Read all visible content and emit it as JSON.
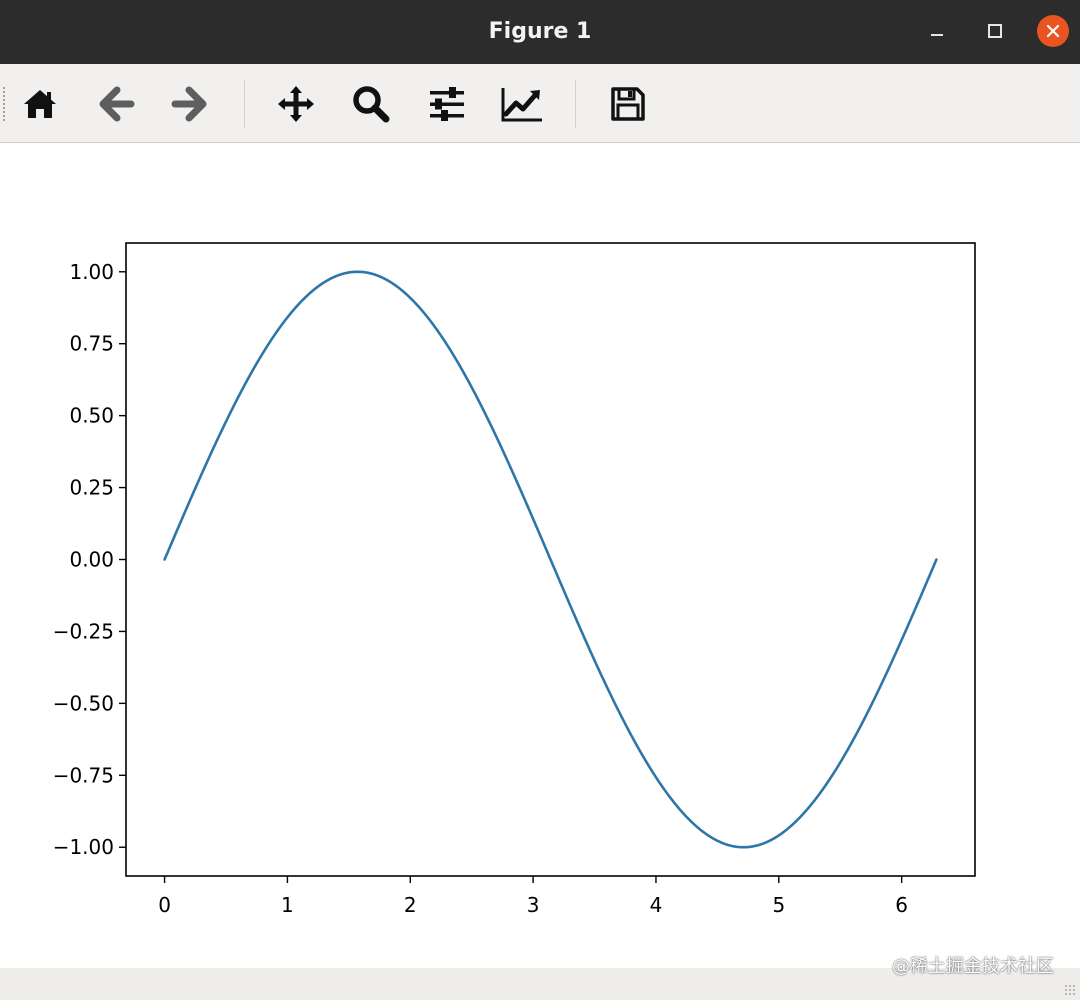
{
  "window": {
    "title": "Figure 1"
  },
  "toolbar": {
    "buttons": [
      {
        "name": "home",
        "icon": "home-icon"
      },
      {
        "name": "back",
        "icon": "arrow-left-icon"
      },
      {
        "name": "forward",
        "icon": "arrow-right-icon"
      },
      {
        "name": "pan",
        "icon": "move-icon"
      },
      {
        "name": "zoom",
        "icon": "magnifier-icon"
      },
      {
        "name": "configure-subplots",
        "icon": "sliders-icon"
      },
      {
        "name": "edit-axis",
        "icon": "line-chart-icon"
      },
      {
        "name": "save",
        "icon": "floppy-disk-icon"
      }
    ]
  },
  "colors": {
    "titlebar": "#2c2c2c",
    "close_button": "#e95420",
    "toolbar": "#f1f0ee",
    "line": "#2e76a8",
    "disabled_icon": "#5e5e5e"
  },
  "watermark": "@稀土掘金技术社区",
  "chart_data": {
    "type": "line",
    "title": "",
    "xlabel": "",
    "ylabel": "",
    "function": "sin(x)",
    "x_range": [
      0,
      6.283
    ],
    "xlim": [
      -0.314,
      6.597
    ],
    "ylim": [
      -1.1,
      1.1
    ],
    "xticks": [
      0,
      1,
      2,
      3,
      4,
      5,
      6
    ],
    "xtick_labels": [
      "0",
      "1",
      "2",
      "3",
      "4",
      "5",
      "6"
    ],
    "yticks": [
      1.0,
      0.75,
      0.5,
      0.25,
      0.0,
      -0.25,
      -0.5,
      -0.75,
      -1.0
    ],
    "ytick_labels": [
      "1.00",
      "0.75",
      "0.50",
      "0.25",
      "0.00",
      "−0.25",
      "−0.50",
      "−0.75",
      "−1.00"
    ],
    "series": [
      {
        "x": [
          0,
          0.5,
          1.0,
          1.5708,
          2.0,
          2.5,
          3.0,
          3.1416,
          3.5,
          4.0,
          4.5,
          4.7124,
          5.0,
          5.5,
          6.0,
          6.283
        ],
        "y": [
          0,
          0.479,
          0.841,
          1.0,
          0.909,
          0.598,
          0.141,
          0.0,
          -0.351,
          -0.757,
          -0.978,
          -1.0,
          -0.959,
          -0.706,
          -0.279,
          0.0
        ]
      }
    ],
    "grid": false,
    "legend": "none"
  }
}
